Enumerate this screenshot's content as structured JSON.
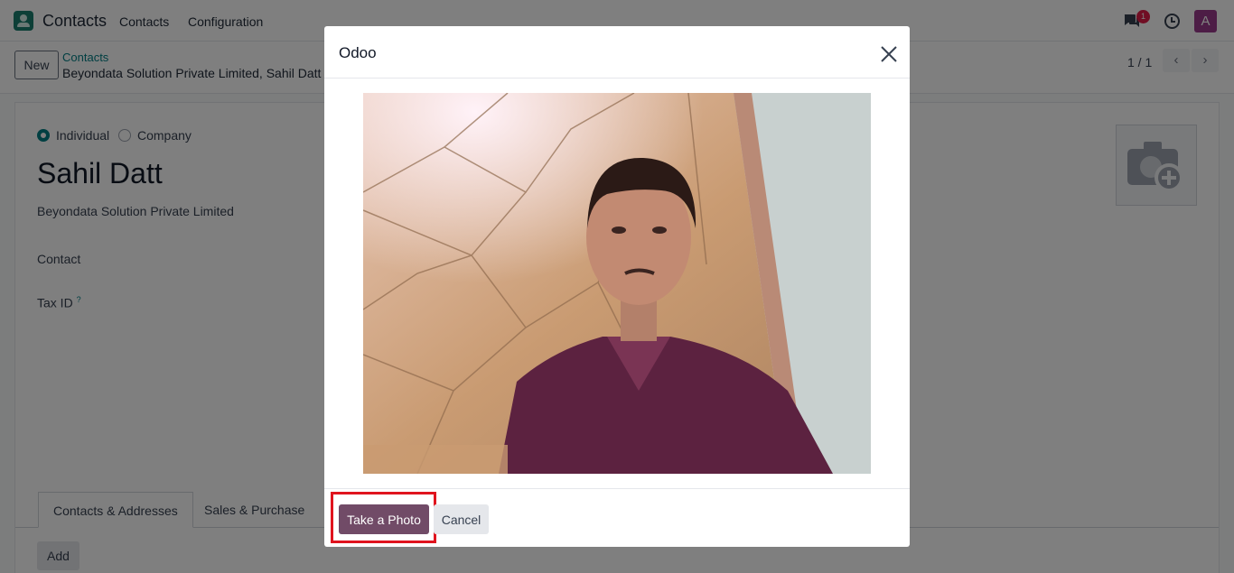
{
  "navbar": {
    "app_name": "Contacts",
    "menu": [
      "Contacts",
      "Configuration"
    ],
    "chat_count": "1",
    "avatar_letter": "A",
    "icons": [
      "contacts-app-icon",
      "chat-icon",
      "clock-icon"
    ]
  },
  "control_panel": {
    "new_label": "New",
    "breadcrumb_parent": "Contacts",
    "breadcrumb_current": "Beyondata Solution Private Limited, Sahil Datt",
    "pager": "1 / 1"
  },
  "form": {
    "type_options": [
      "Individual",
      "Company"
    ],
    "selected_type": "Individual",
    "name": "Sahil Datt",
    "company": "Beyondata Solution Private Limited",
    "contact_label": "Contact",
    "tax_id_label": "Tax ID",
    "tax_id_help": "?",
    "tabs": [
      "Contacts & Addresses",
      "Sales & Purchase"
    ],
    "active_tab": "Contacts & Addresses",
    "add_label": "Add"
  },
  "modal": {
    "title": "Odoo",
    "take_photo_label": "Take a Photo",
    "cancel_label": "Cancel",
    "accent_color": "#714b67",
    "highlight_color": "#e0141e"
  }
}
